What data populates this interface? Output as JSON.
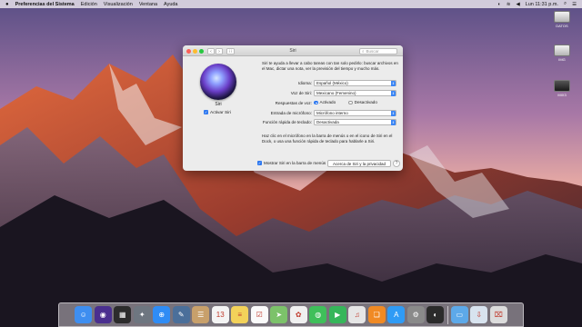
{
  "menubar": {
    "app_name": "Preferencias del Sistema",
    "menus": [
      "Edición",
      "Visualización",
      "Ventana",
      "Ayuda"
    ],
    "clock": "Lun 11:31 p.m."
  },
  "desktop": {
    "icons": [
      {
        "label": "DATOS",
        "icon": "drive-icon"
      },
      {
        "label": "IMG",
        "icon": "drive-icon"
      },
      {
        "label": "MIX3",
        "icon": "dmg-icon"
      }
    ]
  },
  "window": {
    "title": "Siri",
    "search_placeholder": "Buscar",
    "siri_label": "Siri",
    "activate_label": "Activar Siri",
    "description": "Siri te ayuda a llevar a cabo tareas con tan solo pedirlo: buscar archivos en el Mac, dictar una nota, ver la previsión del tiempo y mucho más.",
    "rows": {
      "language": {
        "label": "Idioma:",
        "value": "Español (México)"
      },
      "voice": {
        "label": "Voz de Siri:",
        "value": "Mexicano (Femenino)"
      },
      "feedback": {
        "label": "Respuestas de voz:",
        "on": "Activado",
        "off": "Desactivado"
      },
      "mic": {
        "label": "Entrada de micrófono:",
        "value": "Micrófono interno"
      },
      "shortcut": {
        "label": "Función rápida de teclado:",
        "value": "Desactivada"
      }
    },
    "hint": "Haz clic en el micrófono en la barra de menús o en el icono de Siri en el Dock, o usa una función rápida de teclado para hablarle a Siri.",
    "show_in_menubar": "Mostrar Siri en la barra de menús",
    "privacy_button": "Acerca de Siri y la privacidad",
    "help_button": "?"
  },
  "dock": {
    "apps": [
      {
        "name": "finder-icon",
        "color": "#3e8ef0",
        "glyph": "☺"
      },
      {
        "name": "siri-icon",
        "color": "#4a2f8f",
        "glyph": "◉"
      },
      {
        "name": "mission-control-icon",
        "color": "#2c2c2c",
        "glyph": "▦"
      },
      {
        "name": "launchpad-icon",
        "color": "#6e7680",
        "glyph": "✦"
      },
      {
        "name": "safari-icon",
        "color": "#2f8cf5",
        "glyph": "⊕"
      },
      {
        "name": "photo-app-icon",
        "color": "#4b6f9a",
        "glyph": "✎"
      },
      {
        "name": "contacts-icon",
        "color": "#c8a06b",
        "glyph": "☰"
      },
      {
        "name": "calendar-icon",
        "color": "#f4f4f4",
        "glyph": "13"
      },
      {
        "name": "notes-icon",
        "color": "#f3d25a",
        "glyph": "≡"
      },
      {
        "name": "reminders-icon",
        "color": "#fafafa",
        "glyph": "☑"
      },
      {
        "name": "maps-icon",
        "color": "#7cc26a",
        "glyph": "➤"
      },
      {
        "name": "photos-icon",
        "color": "#f0f0f0",
        "glyph": "✿"
      },
      {
        "name": "messages-icon",
        "color": "#3fbf5a",
        "glyph": "◍"
      },
      {
        "name": "facetime-icon",
        "color": "#36b65a",
        "glyph": "▶"
      },
      {
        "name": "itunes-icon",
        "color": "#e6e6e6",
        "glyph": "♫"
      },
      {
        "name": "ibooks-icon",
        "color": "#f08a24",
        "glyph": "❏"
      },
      {
        "name": "app-store-icon",
        "color": "#2f9bf5",
        "glyph": "A"
      },
      {
        "name": "system-preferences-icon",
        "color": "#8a8a8a",
        "glyph": "⚙"
      },
      {
        "name": "unknown-app-icon",
        "color": "#2b2b2b",
        "glyph": "◐"
      },
      {
        "name": "folder-icon",
        "color": "#5da9e9",
        "glyph": "▭"
      },
      {
        "name": "downloads-icon",
        "color": "#d8e3ef",
        "glyph": "⇩"
      },
      {
        "name": "trash-icon",
        "color": "#dcdcdc",
        "glyph": "⌧"
      }
    ]
  }
}
